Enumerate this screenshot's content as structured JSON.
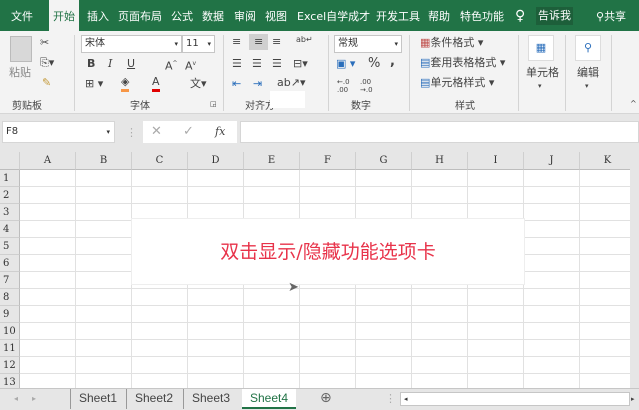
{
  "menu_tabs": [
    "文件",
    "开始",
    "插入",
    "页面布局",
    "公式",
    "数据",
    "审阅",
    "视图",
    "Excel自学成才",
    "开发工具",
    "帮助",
    "特色功能"
  ],
  "active_tab": "开始",
  "tell_me": "告诉我",
  "share": "共享",
  "ribbon": {
    "clipboard": {
      "paste": "粘贴",
      "label": "剪贴板"
    },
    "font": {
      "name": "宋体",
      "size": "11",
      "bold": "B",
      "italic": "I",
      "underline": "U",
      "label": "字体",
      "fill_color": "#f79646",
      "font_color": "#e00000"
    },
    "alignment": {
      "label": "对齐方"
    },
    "number": {
      "format": "常规",
      "percent": "%",
      "comma": ",",
      "label": "数字"
    },
    "styles": {
      "conditional": "条件格式",
      "table": "套用表格格式",
      "cell_styles": "单元格样式",
      "label": "样式"
    },
    "cells": {
      "label": "单元格"
    },
    "editing": {
      "label": "编辑"
    }
  },
  "name_box": "F8",
  "fx": "fx",
  "columns": [
    "A",
    "B",
    "C",
    "D",
    "E",
    "F",
    "G",
    "H",
    "I",
    "J",
    "K"
  ],
  "rows": [
    "1",
    "2",
    "3",
    "4",
    "5",
    "6",
    "7",
    "8",
    "9",
    "10",
    "11",
    "12",
    "13"
  ],
  "sheets": [
    "Sheet1",
    "Sheet2",
    "Sheet3",
    "Sheet4"
  ],
  "active_sheet": "Sheet4",
  "popup_text": "双击显示/隐藏功能选项卡"
}
